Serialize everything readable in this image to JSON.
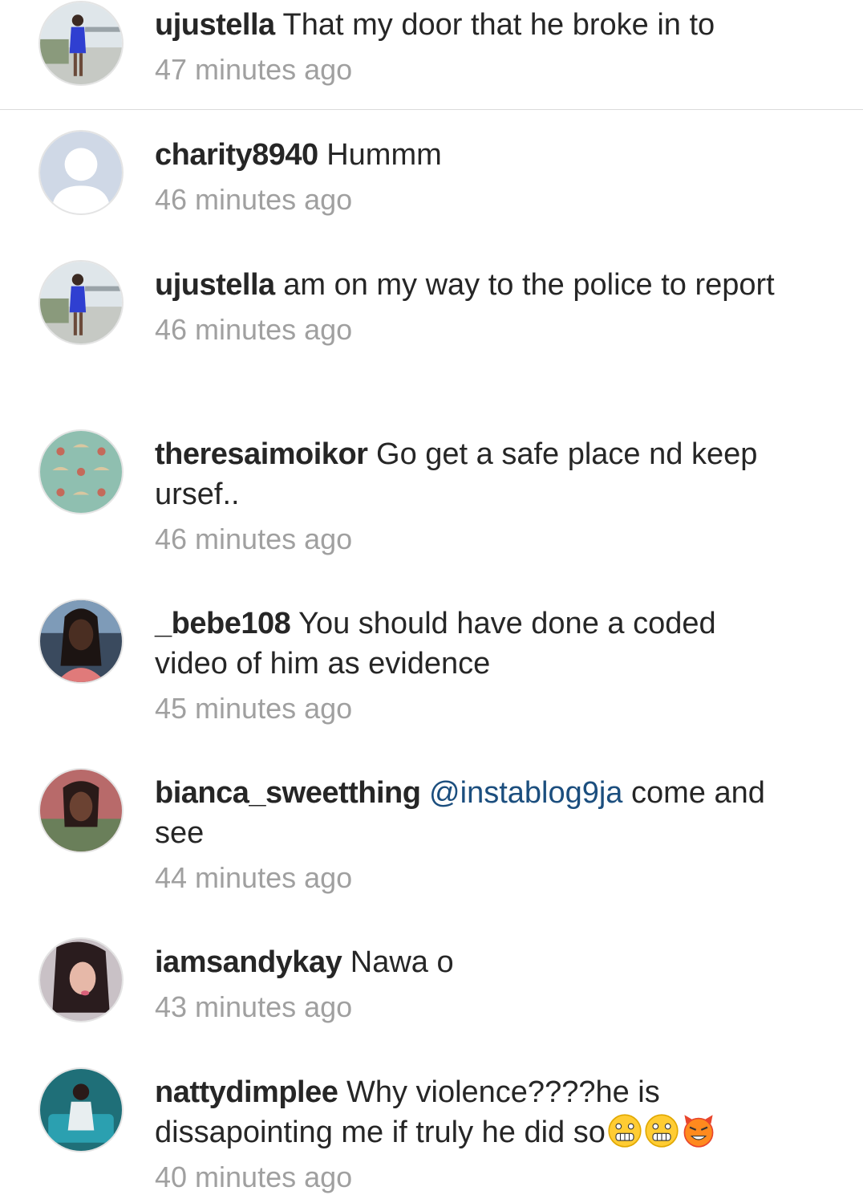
{
  "comments": [
    {
      "user": "ujustella",
      "text": "That my door that he broke in to",
      "time": "47 minutes ago"
    },
    {
      "user": "charity8940",
      "text": "Hummm",
      "time": "46 minutes ago"
    },
    {
      "user": "ujustella",
      "text": "am on my way to the police to report",
      "time": "46 minutes ago"
    },
    {
      "user": "theresaimoikor",
      "text": "Go get a safe place nd keep ursef..",
      "time": "46 minutes ago"
    },
    {
      "user": "_bebe108",
      "text": "You should have done a coded video of him as evidence",
      "time": "45 minutes ago"
    },
    {
      "user": "bianca_sweetthing",
      "mention": "@instablog9ja",
      "text": "come and see",
      "time": "44 minutes ago"
    },
    {
      "user": "iamsandykay",
      "text": "Nawa o",
      "time": "43 minutes ago"
    },
    {
      "user": "nattydimplee",
      "text": "Why violence????he is dissapointing me if truly he did so",
      "time": "40 minutes ago",
      "emojis": [
        "grimacing-face",
        "grimacing-face",
        "smiling-devil"
      ]
    }
  ],
  "colors": {
    "username": "#262626",
    "text": "#262626",
    "timestamp": "#a0a0a0",
    "mention": "#1b4e7e",
    "divider": "#dbdbdb"
  }
}
